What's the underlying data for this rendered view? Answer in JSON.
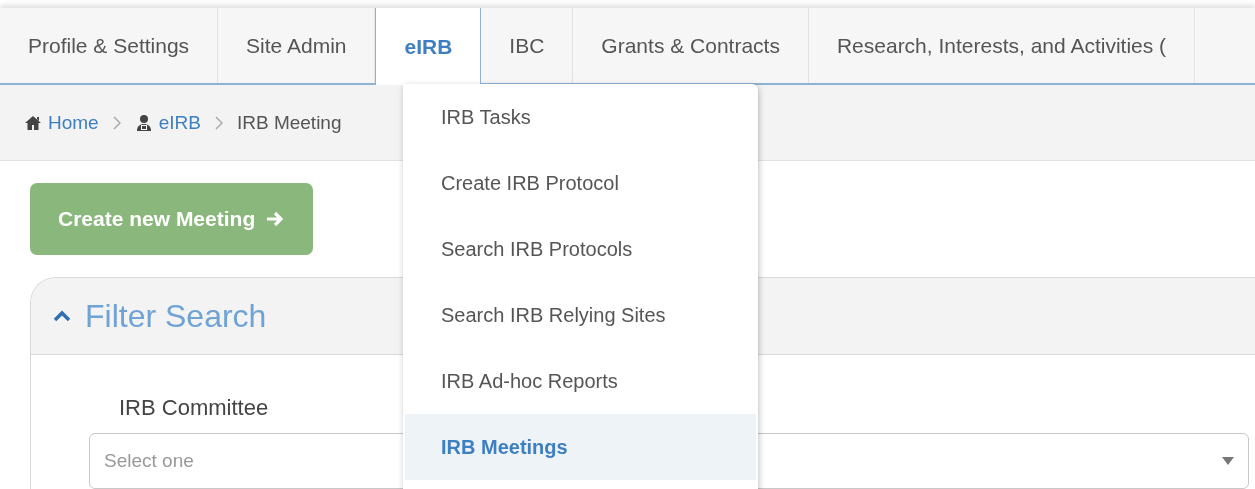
{
  "nav_tabs": [
    {
      "label": "Profile & Settings",
      "selected": false
    },
    {
      "label": "Site Admin",
      "selected": false
    },
    {
      "label": "eIRB",
      "selected": true
    },
    {
      "label": "IBC",
      "selected": false
    },
    {
      "label": "Grants & Contracts",
      "selected": false
    },
    {
      "label": "Research, Interests, and Activities (",
      "selected": false
    }
  ],
  "breadcrumb": [
    {
      "label": "Home",
      "kind": "link"
    },
    {
      "label": "eIRB",
      "kind": "link"
    },
    {
      "label": "IRB Meeting",
      "kind": "current"
    }
  ],
  "create_button": {
    "label": "Create new Meeting"
  },
  "filter_panel": {
    "title": "Filter Search",
    "expanded": true,
    "fields": [
      {
        "label": "IRB Committee",
        "placeholder": "Select one"
      }
    ]
  },
  "dropdown_menu": {
    "items": [
      {
        "label": "IRB Tasks",
        "selected": false
      },
      {
        "label": "Create IRB Protocol",
        "selected": false
      },
      {
        "label": "Search IRB Protocols",
        "selected": false
      },
      {
        "label": "Search IRB Relying Sites",
        "selected": false
      },
      {
        "label": "IRB Ad-hoc Reports",
        "selected": false
      },
      {
        "label": "IRB Meetings",
        "selected": true
      }
    ]
  }
}
